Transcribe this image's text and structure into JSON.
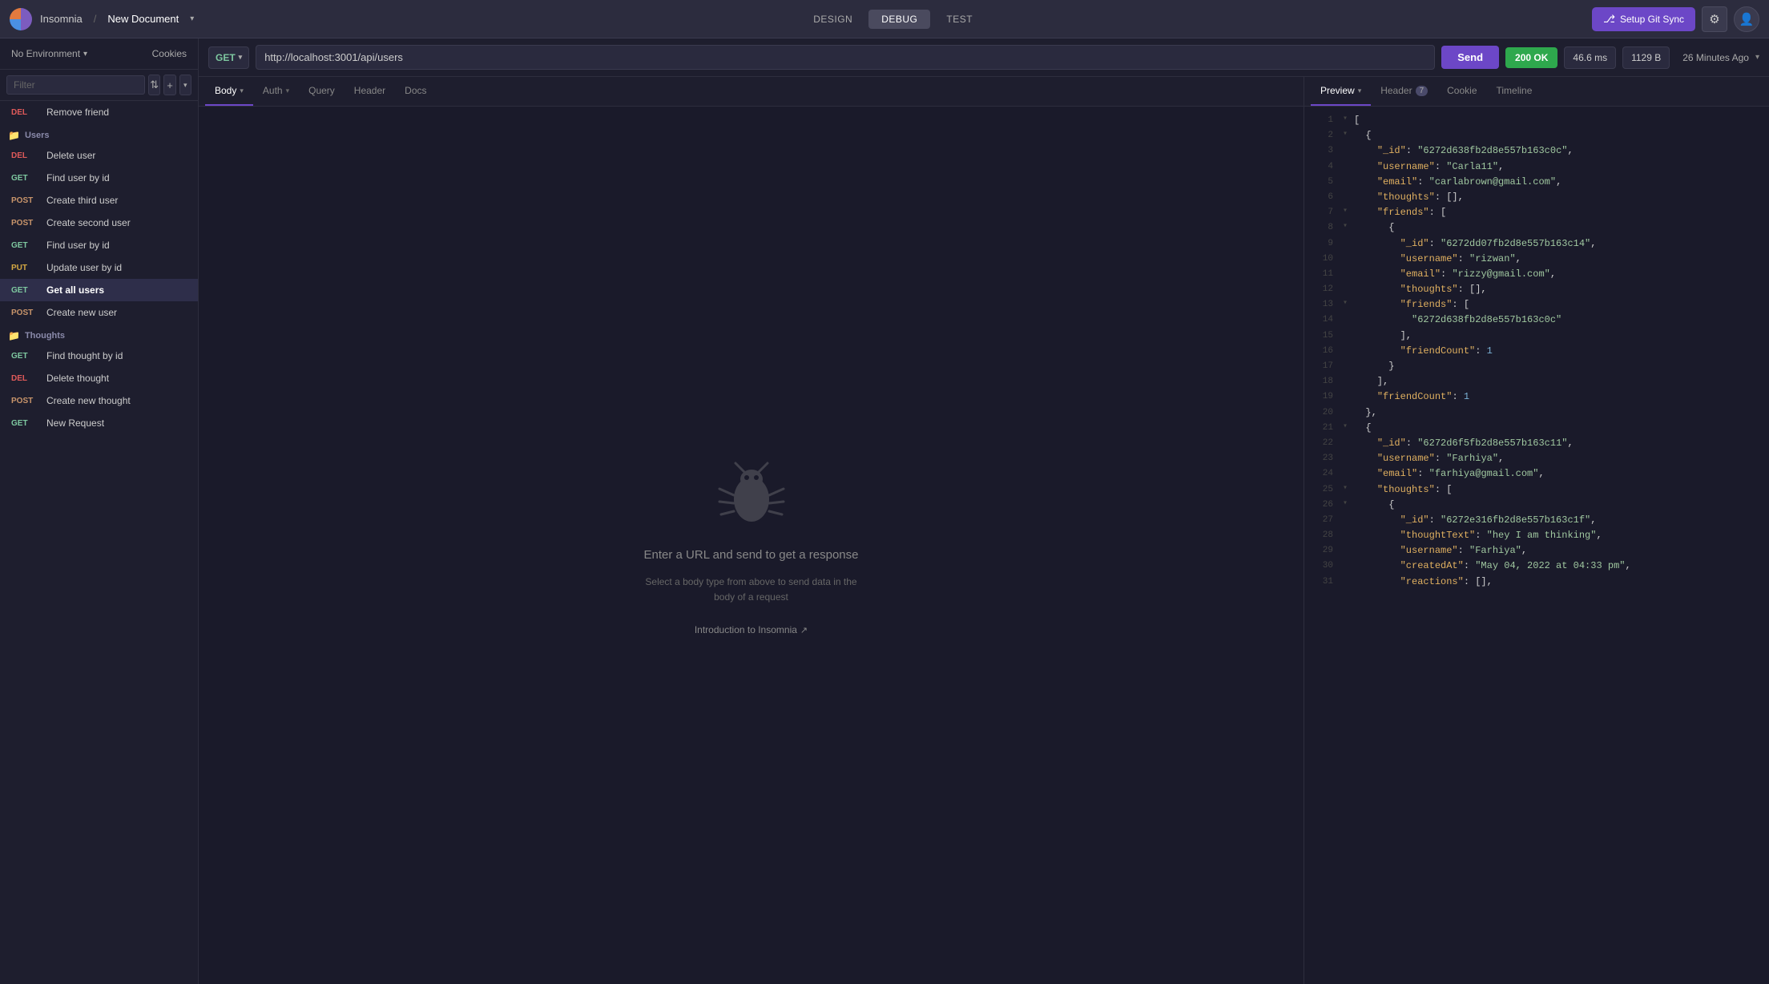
{
  "topbar": {
    "app_name": "Insomnia",
    "sep": "/",
    "doc_name": "New Document",
    "tabs": [
      {
        "id": "design",
        "label": "DESIGN",
        "active": false
      },
      {
        "id": "debug",
        "label": "DEBUG",
        "active": true
      },
      {
        "id": "test",
        "label": "TEST",
        "active": false
      }
    ],
    "git_sync_label": "Setup Git Sync",
    "gear_icon": "⚙",
    "user_icon": "👤"
  },
  "sidebar": {
    "env_label": "No Environment",
    "cookies_label": "Cookies",
    "filter_placeholder": "Filter",
    "items_before": [
      {
        "method": "DEL",
        "label": "Remove friend",
        "active": false
      }
    ],
    "sections": [
      {
        "label": "Users",
        "items": [
          {
            "method": "DEL",
            "label": "Delete user",
            "active": false
          },
          {
            "method": "GET",
            "label": "Find user by id",
            "active": false
          },
          {
            "method": "POST",
            "label": "Create third user",
            "active": false
          },
          {
            "method": "POST",
            "label": "Create second user",
            "active": false
          },
          {
            "method": "GET",
            "label": "Find user by id",
            "active": false
          },
          {
            "method": "PUT",
            "label": "Update user by id",
            "active": false
          },
          {
            "method": "GET",
            "label": "Get all users",
            "active": true
          },
          {
            "method": "POST",
            "label": "Create new user",
            "active": false
          }
        ]
      },
      {
        "label": "Thoughts",
        "items": [
          {
            "method": "GET",
            "label": "Find thought by id",
            "active": false
          },
          {
            "method": "DEL",
            "label": "Delete thought",
            "active": false
          },
          {
            "method": "POST",
            "label": "Create new thought",
            "active": false
          },
          {
            "method": "GET",
            "label": "New Request",
            "active": false
          }
        ]
      }
    ]
  },
  "request": {
    "method": "GET",
    "url": "http://localhost:3001/api/users",
    "send_label": "Send",
    "status": "200 OK",
    "time": "46.6 ms",
    "size": "1129 B",
    "timestamp": "26 Minutes Ago",
    "body_tab": "Body",
    "tabs": [
      "Body",
      "Auth",
      "Query",
      "Header",
      "Docs"
    ],
    "active_tab": "Body"
  },
  "response": {
    "tabs": [
      "Preview",
      "Header",
      "Cookie",
      "Timeline"
    ],
    "active_tab": "Preview",
    "header_badge": "7",
    "empty_title": "Enter a URL and send to get a response",
    "empty_sub": "Select a body type from above to send data in the body of a request",
    "intro_link": "Introduction to Insomnia"
  },
  "code": [
    {
      "n": 1,
      "toggle": "▾",
      "content": "["
    },
    {
      "n": 2,
      "toggle": "▾",
      "content": "  {"
    },
    {
      "n": 3,
      "toggle": "",
      "content": "    <k>\"_id\"</k>: <s>\"6272d638fb2d8e557b163c0c\"</s>,"
    },
    {
      "n": 4,
      "toggle": "",
      "content": "    <k>\"username\"</k>: <s>\"Carla11\"</s>,"
    },
    {
      "n": 5,
      "toggle": "",
      "content": "    <k>\"email\"</k>: <s>\"carlabrown@gmail.com\"</s>,"
    },
    {
      "n": 6,
      "toggle": "",
      "content": "    <k>\"thoughts\"</k>: [],"
    },
    {
      "n": 7,
      "toggle": "▾",
      "content": "    <k>\"friends\"</k>: ["
    },
    {
      "n": 8,
      "toggle": "▾",
      "content": "      {"
    },
    {
      "n": 9,
      "toggle": "",
      "content": "        <k>\"_id\"</k>: <s>\"6272dd07fb2d8e557b163c14\"</s>,"
    },
    {
      "n": 10,
      "toggle": "",
      "content": "        <k>\"username\"</k>: <s>\"rizwan\"</s>,"
    },
    {
      "n": 11,
      "toggle": "",
      "content": "        <k>\"email\"</k>: <s>\"rizzy@gmail.com\"</s>,"
    },
    {
      "n": 12,
      "toggle": "",
      "content": "        <k>\"thoughts\"</k>: [],"
    },
    {
      "n": 13,
      "toggle": "▾",
      "content": "        <k>\"friends\"</k>: ["
    },
    {
      "n": 14,
      "toggle": "",
      "content": "          <s>\"6272d638fb2d8e557b163c0c\"</s>"
    },
    {
      "n": 15,
      "toggle": "",
      "content": "        ],"
    },
    {
      "n": 16,
      "toggle": "",
      "content": "        <k>\"friendCount\"</k>: <num>1</num>"
    },
    {
      "n": 17,
      "toggle": "",
      "content": "      }"
    },
    {
      "n": 18,
      "toggle": "",
      "content": "    ],"
    },
    {
      "n": 19,
      "toggle": "",
      "content": "    <k>\"friendCount\"</k>: <num>1</num>"
    },
    {
      "n": 20,
      "toggle": "",
      "content": "  },"
    },
    {
      "n": 21,
      "toggle": "▾",
      "content": "  {"
    },
    {
      "n": 22,
      "toggle": "",
      "content": "    <k>\"_id\"</k>: <s>\"6272d6f5fb2d8e557b163c11\"</s>,"
    },
    {
      "n": 23,
      "toggle": "",
      "content": "    <k>\"username\"</k>: <s>\"Farhiya\"</s>,"
    },
    {
      "n": 24,
      "toggle": "",
      "content": "    <k>\"email\"</k>: <s>\"farhiya@gmail.com\"</s>,"
    },
    {
      "n": 25,
      "toggle": "▾",
      "content": "    <k>\"thoughts\"</k>: ["
    },
    {
      "n": 26,
      "toggle": "▾",
      "content": "      {"
    },
    {
      "n": 27,
      "toggle": "",
      "content": "        <k>\"_id\"</k>: <s>\"6272e316fb2d8e557b163c1f\"</s>,"
    },
    {
      "n": 28,
      "toggle": "",
      "content": "        <k>\"thoughtText\"</k>: <s>\"hey I am thinking\"</s>,"
    },
    {
      "n": 29,
      "toggle": "",
      "content": "        <k>\"username\"</k>: <s>\"Farhiya\"</s>,"
    },
    {
      "n": 30,
      "toggle": "",
      "content": "        <k>\"createdAt\"</k>: <s>\"May 04, 2022 at 04:33 pm\"</s>,"
    },
    {
      "n": 31,
      "toggle": "",
      "content": "        <k>\"reactions\"</k>: [],"
    }
  ],
  "colors": {
    "accent": "#6c47c7",
    "get": "#7ec8a0",
    "post": "#c9956b",
    "put": "#d4a843",
    "del": "#e05a5a",
    "status_ok": "#2ea84d"
  }
}
